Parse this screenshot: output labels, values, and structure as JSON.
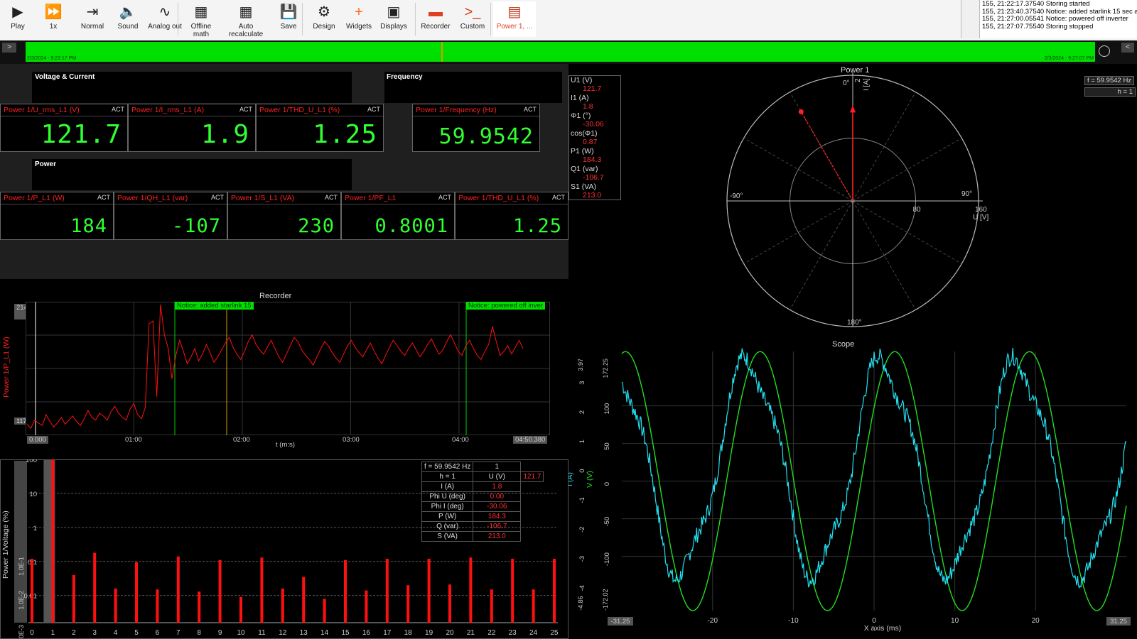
{
  "toolbar": {
    "buttons": [
      {
        "label": "Play",
        "icon": "play-icon"
      },
      {
        "label": "1x",
        "icon": "fast-forward-icon"
      },
      {
        "label": "Normal",
        "icon": "normal-icon"
      },
      {
        "label": "Sound",
        "icon": "sound-mute-icon"
      },
      {
        "label": "Analog out",
        "icon": "analog-out-icon"
      },
      {
        "label": "Offline math",
        "icon": "calculator-icon"
      },
      {
        "label": "Auto recalculate",
        "icon": "auto-calc-icon"
      },
      {
        "label": "Save",
        "icon": "save-icon"
      },
      {
        "label": "Design",
        "icon": "gear-icon"
      },
      {
        "label": "Widgets",
        "icon": "plus-icon"
      },
      {
        "label": "Displays",
        "icon": "displays-icon"
      },
      {
        "label": "Recorder",
        "icon": "recorder-icon"
      },
      {
        "label": "Custom",
        "icon": "terminal-icon"
      },
      {
        "label": "Power 1, ...",
        "icon": "power-icon"
      }
    ]
  },
  "log": [
    "155, 21:22:17.37540 Storing started",
    "155, 21:23:40.37540 Notice: added starlink 15 sec ago",
    "155, 21:27:00.05541 Notice: powered off inverter",
    "155, 21:27:07.75540 Storing stopped"
  ],
  "timeline": {
    "start": "2/3/2024 - 9:22:17 PM",
    "end": "2/3/2024 - 9:27:07 PM"
  },
  "voltage_current": {
    "title": "Voltage & Current",
    "meters": [
      {
        "label": "Power 1/U_rms_L1 (V)",
        "tag": "ACT",
        "value": "121.7"
      },
      {
        "label": "Power 1/I_rms_L1 (A)",
        "tag": "ACT",
        "value": "1.9"
      },
      {
        "label": "Power 1/THD_U_L1 (%)",
        "tag": "ACT",
        "value": "1.25"
      }
    ]
  },
  "frequency": {
    "title": "Frequency",
    "meter": {
      "label": "Power 1/Frequency (Hz)",
      "tag": "ACT",
      "value": "59.9542"
    }
  },
  "power": {
    "title": "Power",
    "meters": [
      {
        "label": "Power 1/P_L1 (W)",
        "tag": "ACT",
        "value": "184"
      },
      {
        "label": "Power 1/QH_L1 (var)",
        "tag": "ACT",
        "value": "-107"
      },
      {
        "label": "Power 1/S_L1 (VA)",
        "tag": "ACT",
        "value": "230"
      },
      {
        "label": "Power 1/PF_L1",
        "tag": "ACT",
        "value": "0.8001"
      },
      {
        "label": "Power 1/THD_U_L1 (%)",
        "tag": "ACT",
        "value": "1.25"
      }
    ]
  },
  "phasor": {
    "title": "Power 1",
    "info": [
      {
        "k": "U1 (V)",
        "v": "121.7"
      },
      {
        "k": "I1 (A)",
        "v": "1.8"
      },
      {
        "k": "Φ1 (°)",
        "v": "-30.06"
      },
      {
        "k": "cos(Φ1)",
        "v": "0.87"
      },
      {
        "k": "P1 (W)",
        "v": "184.3"
      },
      {
        "k": "Q1 (var)",
        "v": "-106.7"
      },
      {
        "k": "S1 (VA)",
        "v": "213.0"
      }
    ],
    "freq": "f = 59.9542 Hz",
    "harm": "h = 1",
    "angle_labels": {
      "top": "0°",
      "left": "-90°",
      "right": "90°",
      "bottom": "180°"
    },
    "radial_ticks": [
      "80",
      "160"
    ],
    "u_axis": "U [V]",
    "i_axis": "I [A]",
    "i_tick": "2",
    "colors": {
      "voltage": "#ff2020",
      "current": "#ff2020"
    }
  },
  "recorder": {
    "title": "Recorder",
    "ylabel": "Power 1/P_L1 (W)",
    "xlabel": "t (m:s)",
    "ymax": "214",
    "ymin": "117",
    "xticks": [
      "0.000",
      "01:00",
      "02:00",
      "03:00",
      "04:00",
      "04:50.380"
    ],
    "notices": [
      "Notice: added starlink 15",
      "Notice: powered off inver"
    ],
    "line_color": "#ff1010",
    "y_unit_range": [
      117,
      214
    ],
    "duration_s": 290.38,
    "series_samples": [
      125,
      122,
      128,
      126,
      124,
      132,
      127,
      123,
      126,
      130,
      125,
      128,
      131,
      127,
      124,
      129,
      135,
      130,
      128,
      133,
      131,
      128,
      134,
      138,
      133,
      130,
      128,
      136,
      140,
      132,
      129,
      137,
      198,
      200,
      145,
      212,
      190,
      180,
      158,
      175,
      186,
      178,
      169,
      174,
      180,
      171,
      176,
      183,
      177,
      170,
      174,
      179,
      184,
      188,
      181,
      176,
      172,
      178,
      185,
      190,
      183,
      179,
      176,
      181,
      186,
      180,
      174,
      170,
      176,
      182,
      188,
      185,
      179,
      175,
      172,
      168,
      174,
      180,
      185,
      182,
      177,
      173,
      170,
      176,
      182,
      186,
      181,
      177,
      174,
      179,
      184,
      178,
      173,
      169,
      175,
      181,
      186,
      182,
      178,
      175,
      180,
      184,
      179,
      174,
      178,
      183,
      187,
      181,
      176,
      179,
      185,
      190,
      184,
      178,
      175,
      182,
      186,
      180,
      175,
      172,
      178,
      183,
      196,
      185,
      175,
      178,
      182,
      176,
      181,
      186,
      180
    ]
  },
  "harmonics": {
    "ylabel": "Power 1/Voltage (%)",
    "yticks": [
      "100",
      "10",
      "1",
      "0.1",
      "0.01"
    ],
    "ytick_extra": [
      "1.0E-1",
      "1.0E-2",
      "1.0E-3"
    ],
    "xticks": [
      "0",
      "1",
      "2",
      "3",
      "4",
      "5",
      "6",
      "7",
      "8",
      "9",
      "10",
      "11",
      "12",
      "13",
      "14",
      "15",
      "16",
      "17",
      "18",
      "19",
      "20",
      "21",
      "22",
      "23",
      "24",
      "25"
    ],
    "values_pct": [
      0.12,
      100,
      0.04,
      0.18,
      0.016,
      0.095,
      0.015,
      0.14,
      0.013,
      0.11,
      0.009,
      0.13,
      0.016,
      0.035,
      0.008,
      0.11,
      0.014,
      0.12,
      0.02,
      0.12,
      0.021,
      0.13,
      0.015,
      0.12,
      0.015,
      0.12
    ],
    "freq": "f = 59.9542 Hz",
    "harm": "h = 1",
    "col_header": "1",
    "table": [
      {
        "k": "U (V)",
        "v": "121.7"
      },
      {
        "k": "I (A)",
        "v": "1.8"
      },
      {
        "k": "Phi U (deg)",
        "v": "0.00"
      },
      {
        "k": "Phi I (deg)",
        "v": "-30.06"
      },
      {
        "k": "P (W)",
        "v": "184.3"
      },
      {
        "k": "Q (var)",
        "v": "-106.7"
      },
      {
        "k": "S (VA)",
        "v": "213.0"
      }
    ]
  },
  "scope": {
    "title": "Scope",
    "xlabel": "X axis (ms)",
    "xticks": [
      "-20",
      "-10",
      "0",
      "10",
      "20"
    ],
    "x_min": "-31.25",
    "x_max": "31.25",
    "v_label": "V (V)",
    "i_label": "I (A)",
    "v_ticks": [
      "100",
      "50",
      "0",
      "-50",
      "-100"
    ],
    "v_max": "172.25",
    "v_min": "-172.02",
    "i_ticks": [
      "3",
      "2",
      "1",
      "0",
      "-1",
      "-2",
      "-3",
      "-4"
    ],
    "i_max": "3.97",
    "i_min": "-4.86",
    "v_color": "#22dd22",
    "i_color": "#22e0f0",
    "v_amplitude": 172,
    "i_amplitude": 3.9,
    "period_ms": 16.68,
    "phase_shift_deg": 30
  }
}
